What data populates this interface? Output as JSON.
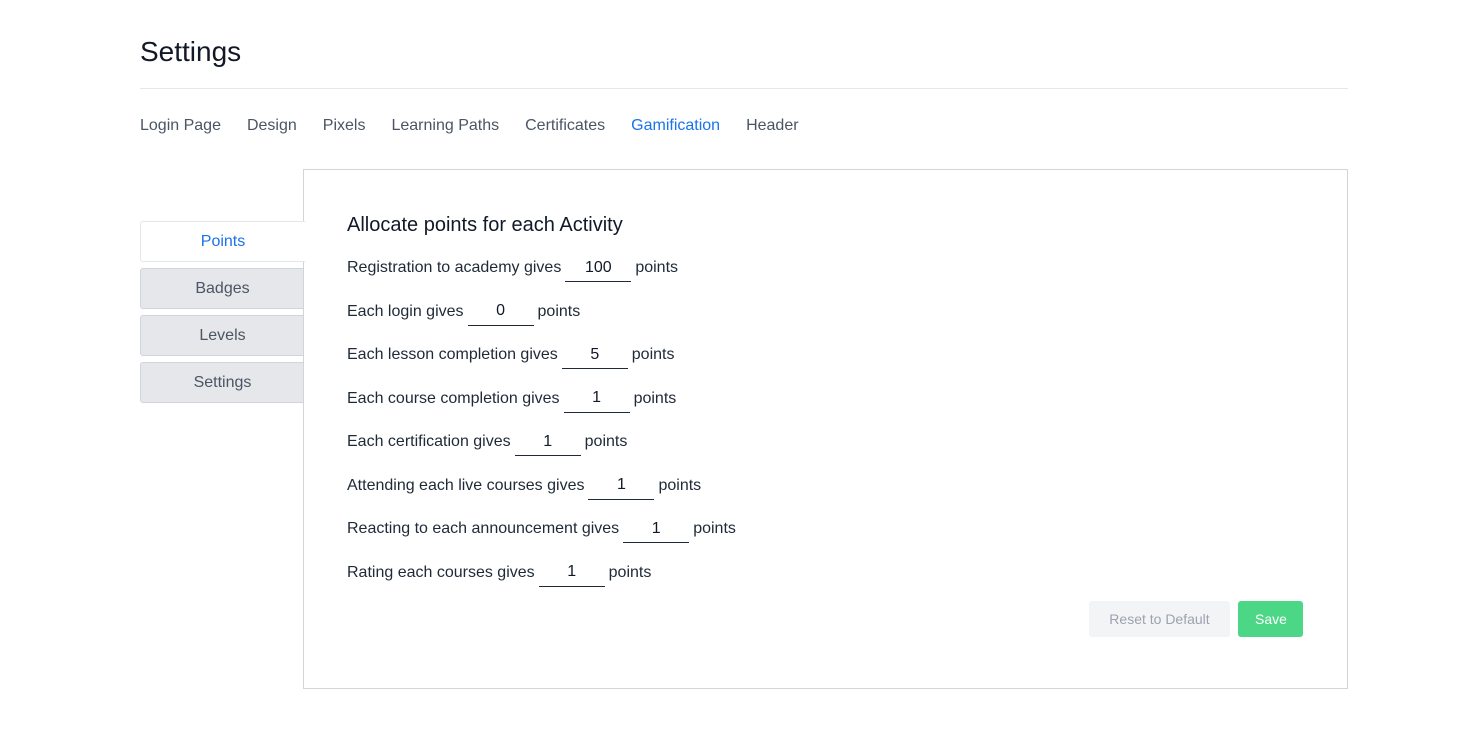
{
  "page": {
    "title": "Settings"
  },
  "top_tabs": [
    {
      "label": "Login Page",
      "active": false
    },
    {
      "label": "Design",
      "active": false
    },
    {
      "label": "Pixels",
      "active": false
    },
    {
      "label": "Learning Paths",
      "active": false
    },
    {
      "label": "Certificates",
      "active": false
    },
    {
      "label": "Gamification",
      "active": true
    },
    {
      "label": "Header",
      "active": false
    }
  ],
  "side_tabs": [
    {
      "label": "Points",
      "active": true
    },
    {
      "label": "Badges",
      "active": false
    },
    {
      "label": "Levels",
      "active": false
    },
    {
      "label": "Settings",
      "active": false
    }
  ],
  "panel": {
    "title": "Allocate points for each Activity",
    "unit_label": "points",
    "rows": [
      {
        "label": "Registration to academy gives",
        "value": "100"
      },
      {
        "label": "Each login gives",
        "value": "0"
      },
      {
        "label": "Each lesson completion gives",
        "value": "5"
      },
      {
        "label": "Each course completion gives",
        "value": "1"
      },
      {
        "label": "Each certification gives",
        "value": "1"
      },
      {
        "label": "Attending each live courses gives",
        "value": "1"
      },
      {
        "label": "Reacting to each announcement gives",
        "value": "1"
      },
      {
        "label": "Rating each courses gives",
        "value": "1"
      }
    ],
    "reset_label": "Reset to Default",
    "save_label": "Save"
  },
  "colors": {
    "accent": "#1a73e8",
    "save": "#4cd787",
    "inactive_tab_bg": "#e5e7eb"
  }
}
